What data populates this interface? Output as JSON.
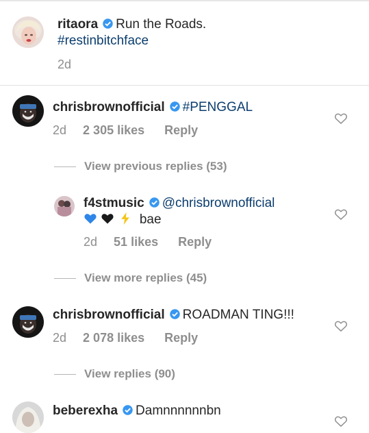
{
  "post": {
    "username": "ritaora",
    "caption": "Run the Roads.",
    "hashtag": "#restinbitchface",
    "age": "2d"
  },
  "comments": [
    {
      "username": "chrisbrownofficial",
      "text": "#PENGGAL",
      "age": "2d",
      "likes": "2 305 likes",
      "reply_label": "Reply",
      "view_replies": "View previous replies (53)"
    },
    {
      "username": "f4stmusic",
      "mention": "@chrisbrownofficial",
      "text": "bae",
      "emojis": [
        "blue-heart-icon",
        "black-heart-icon",
        "lightning-icon"
      ],
      "age": "2d",
      "likes": "51 likes",
      "reply_label": "Reply",
      "view_replies": "View more replies (45)"
    },
    {
      "username": "chrisbrownofficial",
      "text": "ROADMAN TING!!!",
      "age": "2d",
      "likes": "2 078 likes",
      "reply_label": "Reply",
      "view_replies": "View replies (90)"
    },
    {
      "username": "beberexha",
      "text": "Damnnnnnnbn"
    }
  ],
  "colors": {
    "verified": "#3897f0",
    "link": "#0b3d6e",
    "muted": "#8e8e8e"
  }
}
